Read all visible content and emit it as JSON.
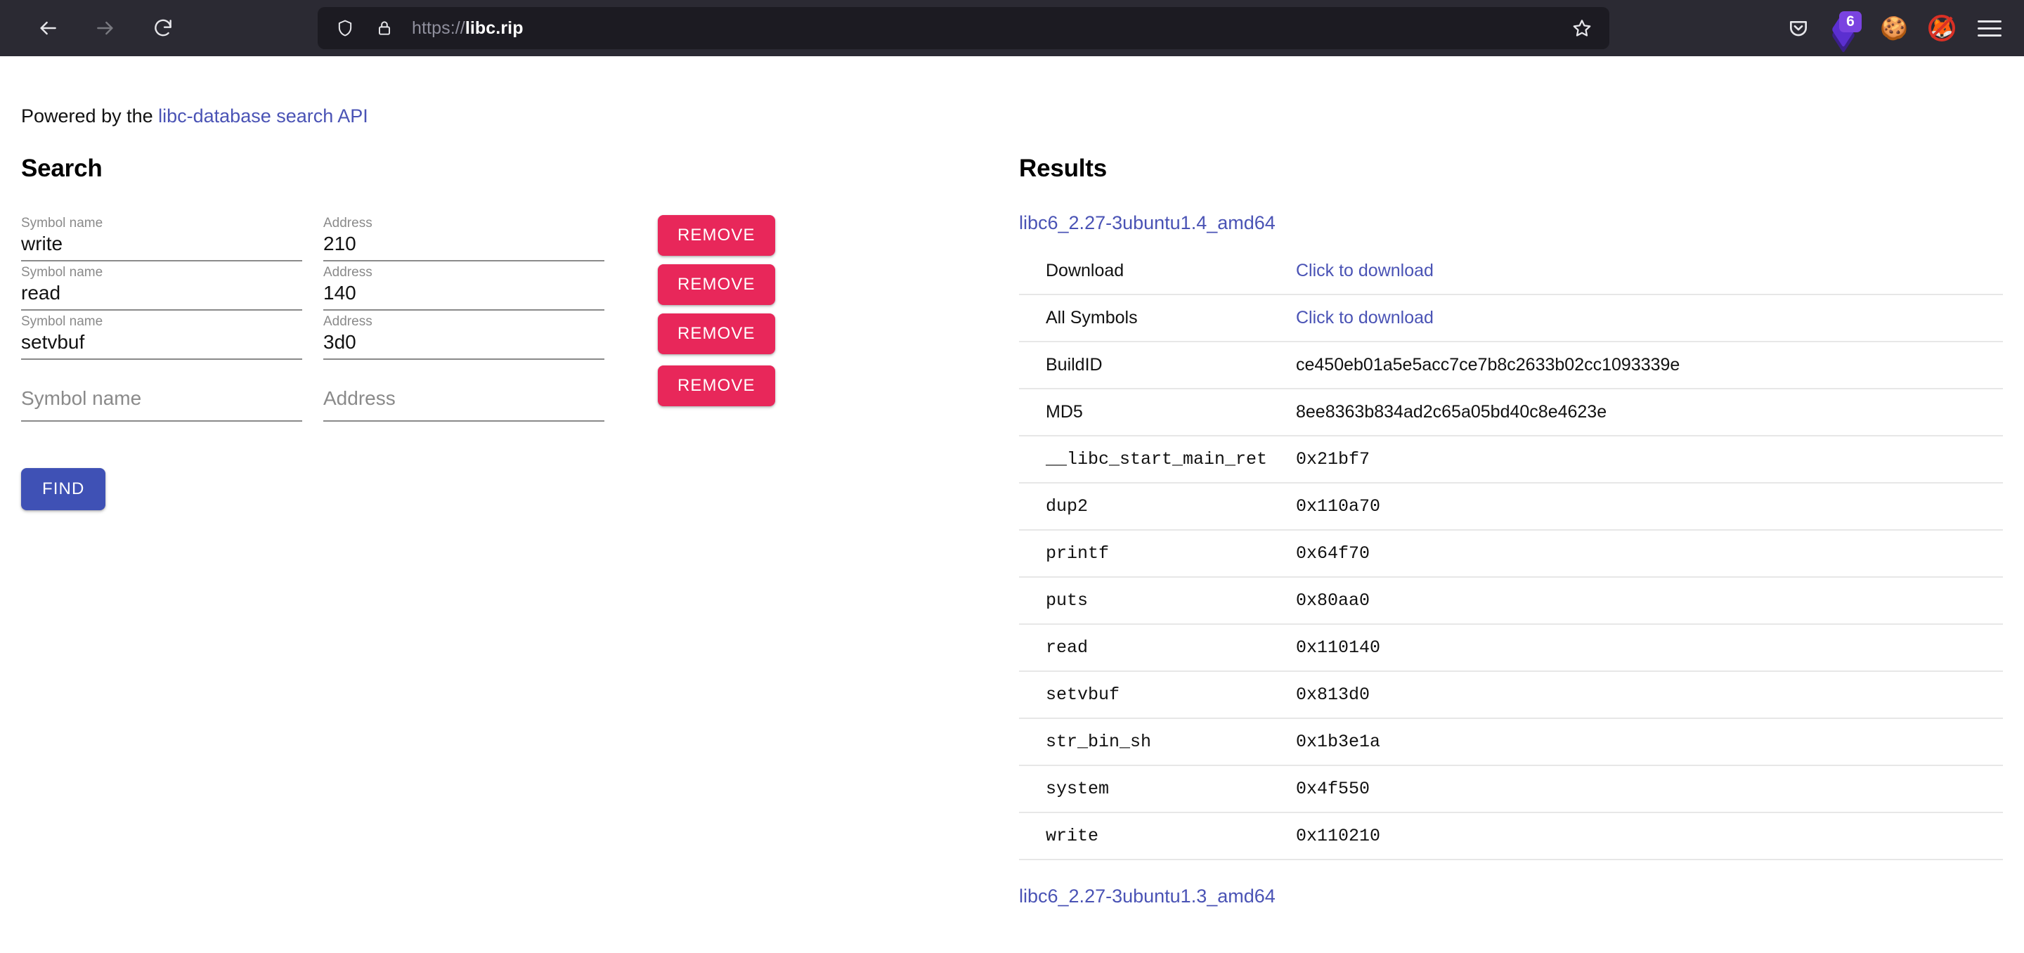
{
  "browser": {
    "back_label": "Back",
    "forward_label": "Forward",
    "reload_label": "Reload",
    "url_scheme": "https://",
    "url_host": "libc.rip",
    "url_full": "https://libc.rip",
    "bookmark_label": "Bookmark this page",
    "extensions": {
      "pocket_label": "Pocket",
      "layers_label": "Extension",
      "layers_badge": "6",
      "cookie_glyph": "🍪",
      "cookie_label": "Cookie extension",
      "fox_glyph": "🦊",
      "nofox_label": "Disabled fox extension",
      "menu_label": "Open application menu"
    }
  },
  "page": {
    "powered_prefix": "Powered by the ",
    "powered_link": "libc-database search API"
  },
  "search": {
    "heading": "Search",
    "symbol_label": "Symbol name",
    "address_label": "Address",
    "symbol_placeholder": "Symbol name",
    "address_placeholder": "Address",
    "remove_label": "REMOVE",
    "find_label": "FIND",
    "rows": [
      {
        "symbol": "write",
        "address": "210"
      },
      {
        "symbol": "read",
        "address": "140"
      },
      {
        "symbol": "setvbuf",
        "address": "3d0"
      },
      {
        "symbol": "",
        "address": ""
      }
    ]
  },
  "results": {
    "heading": "Results",
    "items": [
      {
        "name": "libc6_2.27-3ubuntu1.4_amd64",
        "rows": [
          {
            "key": "Download",
            "value": "Click to download",
            "type": "link"
          },
          {
            "key": "All Symbols",
            "value": "Click to download",
            "type": "link"
          },
          {
            "key": "BuildID",
            "value": "ce450eb01a5e5acc7ce7b8c2633b02cc1093339e",
            "type": "text"
          },
          {
            "key": "MD5",
            "value": "8ee8363b834ad2c65a05bd40c8e4623e",
            "type": "text"
          },
          {
            "key": "__libc_start_main_ret",
            "value": "0x21bf7",
            "type": "mono"
          },
          {
            "key": "dup2",
            "value": "0x110a70",
            "type": "mono"
          },
          {
            "key": "printf",
            "value": "0x64f70",
            "type": "mono"
          },
          {
            "key": "puts",
            "value": "0x80aa0",
            "type": "mono"
          },
          {
            "key": "read",
            "value": "0x110140",
            "type": "mono"
          },
          {
            "key": "setvbuf",
            "value": "0x813d0",
            "type": "mono"
          },
          {
            "key": "str_bin_sh",
            "value": "0x1b3e1a",
            "type": "mono"
          },
          {
            "key": "system",
            "value": "0x4f550",
            "type": "mono"
          },
          {
            "key": "write",
            "value": "0x110210",
            "type": "mono"
          }
        ]
      }
    ],
    "next_item_name": "libc6_2.27-3ubuntu1.3_amd64"
  },
  "colors": {
    "accent_indigo": "#3f51b5",
    "accent_pink": "#e8275a",
    "link": "#4a53b5",
    "chrome_bg": "#2b2a33",
    "urlbar_bg": "#1c1b22"
  }
}
